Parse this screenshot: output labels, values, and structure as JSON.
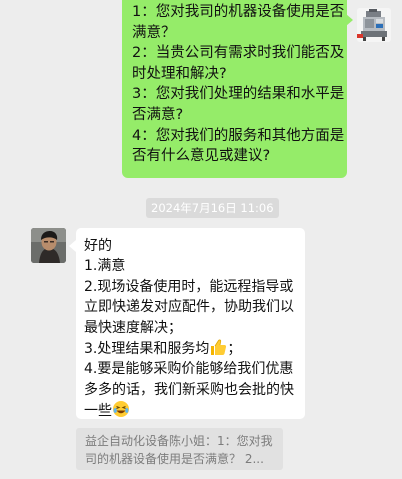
{
  "outgoing_message": {
    "lines": [
      "1：您对我司的机器设备使用是否",
      "满意？",
      "2：当贵公司有需求时我们能否及",
      "时处理和解决?",
      "3：您对我们处理的结果和水平是",
      "否满意?",
      "4：您对我们的服务和其他方面是",
      "否有什么意见或建议?"
    ],
    "bubble_color": "#95ec69"
  },
  "timestamp": "2024年7月16日 11:06",
  "incoming_message": {
    "lines": [
      "好的",
      "1.满意",
      "2.现场设备使用时，能远程指导或",
      "立即快递发对应配件，协助我们以",
      "最快速度解决；",
      "3.处理结果和服务均",
      "4.要是能够采购价能够给我们优惠",
      "多多的话，我们新采购也会批的快",
      "一些"
    ],
    "line6_suffix": "；",
    "emoji_thumbs": "thumbs-up-emoji",
    "emoji_laugh": "laughing-emoji",
    "bubble_color": "#ffffff"
  },
  "quote": {
    "lines": [
      "益企自动化设备陈小姐：1：您对我",
      "司的机器设备使用是否满意？ 2..."
    ]
  }
}
